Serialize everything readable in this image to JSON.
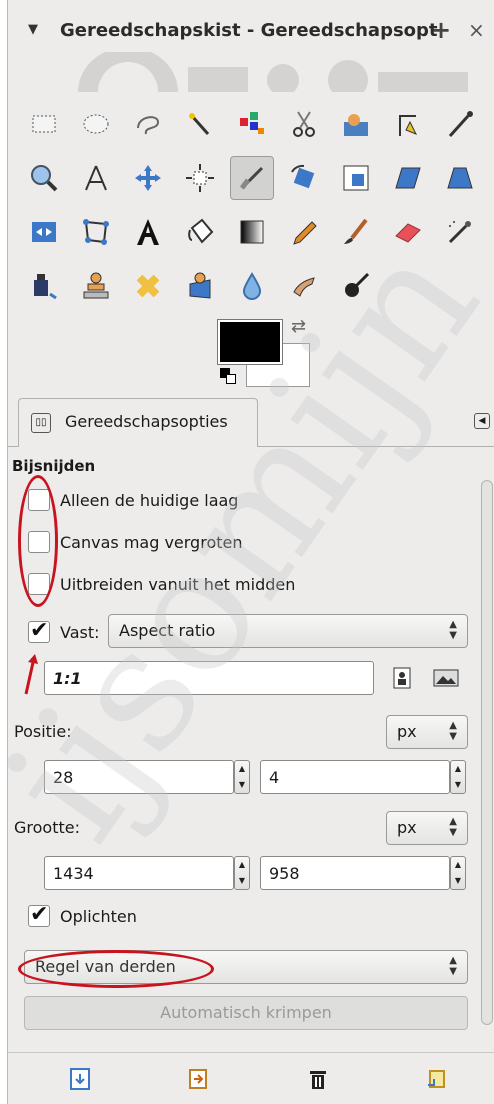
{
  "window": {
    "title": "Gereedschapskist - Gereedschapsopt",
    "plus_glyph": "+",
    "close_glyph": "×"
  },
  "tools": [
    {
      "name": "rect-select-icon"
    },
    {
      "name": "ellipse-select-icon"
    },
    {
      "name": "free-select-icon"
    },
    {
      "name": "fuzzy-select-icon"
    },
    {
      "name": "color-select-icon"
    },
    {
      "name": "scissors-select-icon"
    },
    {
      "name": "foreground-select-icon"
    },
    {
      "name": "paths-icon"
    },
    {
      "name": "color-picker-icon"
    },
    {
      "name": "zoom-icon"
    },
    {
      "name": "measure-icon"
    },
    {
      "name": "move-icon"
    },
    {
      "name": "align-icon"
    },
    {
      "name": "crop-icon",
      "active": true
    },
    {
      "name": "rotate-icon"
    },
    {
      "name": "scale-icon"
    },
    {
      "name": "shear-icon"
    },
    {
      "name": "perspective-icon"
    },
    {
      "name": "flip-icon"
    },
    {
      "name": "cage-transform-icon"
    },
    {
      "name": "text-icon"
    },
    {
      "name": "bucket-fill-icon"
    },
    {
      "name": "blend-icon"
    },
    {
      "name": "pencil-icon"
    },
    {
      "name": "paintbrush-icon"
    },
    {
      "name": "eraser-icon"
    },
    {
      "name": "airbrush-icon"
    },
    {
      "name": "ink-icon"
    },
    {
      "name": "clone-icon"
    },
    {
      "name": "heal-icon"
    },
    {
      "name": "perspective-clone-icon"
    },
    {
      "name": "blur-sharpen-icon"
    },
    {
      "name": "smudge-icon"
    },
    {
      "name": "dodge-burn-icon"
    }
  ],
  "colors": {
    "foreground": "#000000",
    "background": "#ffffff",
    "annotation": "#c8141e"
  },
  "tab": {
    "icon_text": "▯▯",
    "label": "Gereedschapsopties"
  },
  "options": {
    "section_title": "Bijsnijden",
    "current_layer_only": {
      "label": "Alleen de huidige laag",
      "checked": false
    },
    "allow_growing": {
      "label": "Canvas mag vergroten",
      "checked": false
    },
    "expand_from_center": {
      "label": "Uitbreiden vanuit het midden",
      "checked": false
    },
    "fixed": {
      "label": "Vast:",
      "checked": true,
      "mode": "Aspect ratio"
    },
    "ratio_value": "1:1",
    "position": {
      "label": "Positie:",
      "unit": "px",
      "x": "28",
      "y": "4"
    },
    "size": {
      "label": "Grootte:",
      "unit": "px",
      "w": "1434",
      "h": "958"
    },
    "highlight": {
      "label": "Oplichten",
      "checked": true
    },
    "guides": "Regel van derden",
    "auto_shrink": "Automatisch krimpen"
  },
  "watermark": "ijsomijn"
}
